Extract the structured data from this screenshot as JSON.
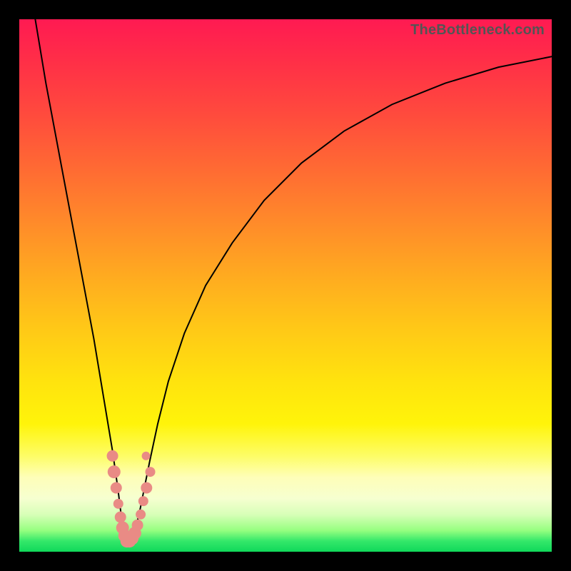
{
  "watermark": "TheBottleneck.com",
  "colors": {
    "frame": "#000000",
    "curve": "#000000",
    "marker": "#e98b85",
    "gradient_top": "#ff1a52",
    "gradient_bottom": "#10d85a"
  },
  "chart_data": {
    "type": "line",
    "title": "",
    "xlabel": "",
    "ylabel": "",
    "xlim": [
      0,
      100
    ],
    "ylim": [
      0,
      100
    ],
    "grid": false,
    "series": [
      {
        "name": "bottleneck-curve",
        "x": [
          3,
          5,
          8,
          11,
          14,
          16,
          17.5,
          18.5,
          19,
          19.3,
          19.6,
          20,
          20.5,
          21,
          21.5,
          22,
          22.7,
          23.5,
          24.5,
          26,
          28,
          31,
          35,
          40,
          46,
          53,
          61,
          70,
          80,
          90,
          100
        ],
        "y": [
          100,
          88,
          72,
          56,
          40,
          28,
          19,
          12,
          8,
          5.5,
          3.5,
          2,
          1.2,
          1.6,
          3,
          5,
          8,
          12,
          17,
          24,
          32,
          41,
          50,
          58,
          66,
          73,
          79,
          84,
          88,
          91,
          93
        ]
      }
    ],
    "markers": [
      {
        "x": 17.5,
        "y": 18,
        "r": 8
      },
      {
        "x": 17.8,
        "y": 15,
        "r": 9
      },
      {
        "x": 18.2,
        "y": 12,
        "r": 8
      },
      {
        "x": 18.6,
        "y": 9,
        "r": 7
      },
      {
        "x": 19.0,
        "y": 6.5,
        "r": 8
      },
      {
        "x": 19.4,
        "y": 4.5,
        "r": 9
      },
      {
        "x": 19.8,
        "y": 3,
        "r": 9
      },
      {
        "x": 20.2,
        "y": 2,
        "r": 9
      },
      {
        "x": 20.7,
        "y": 2,
        "r": 9
      },
      {
        "x": 21.2,
        "y": 2.5,
        "r": 9
      },
      {
        "x": 21.7,
        "y": 3.5,
        "r": 9
      },
      {
        "x": 22.2,
        "y": 5,
        "r": 8
      },
      {
        "x": 22.8,
        "y": 7,
        "r": 7
      },
      {
        "x": 23.3,
        "y": 9.5,
        "r": 7
      },
      {
        "x": 23.9,
        "y": 12,
        "r": 8
      },
      {
        "x": 24.6,
        "y": 15,
        "r": 7
      },
      {
        "x": 23.8,
        "y": 18,
        "r": 6
      }
    ],
    "annotations": []
  }
}
